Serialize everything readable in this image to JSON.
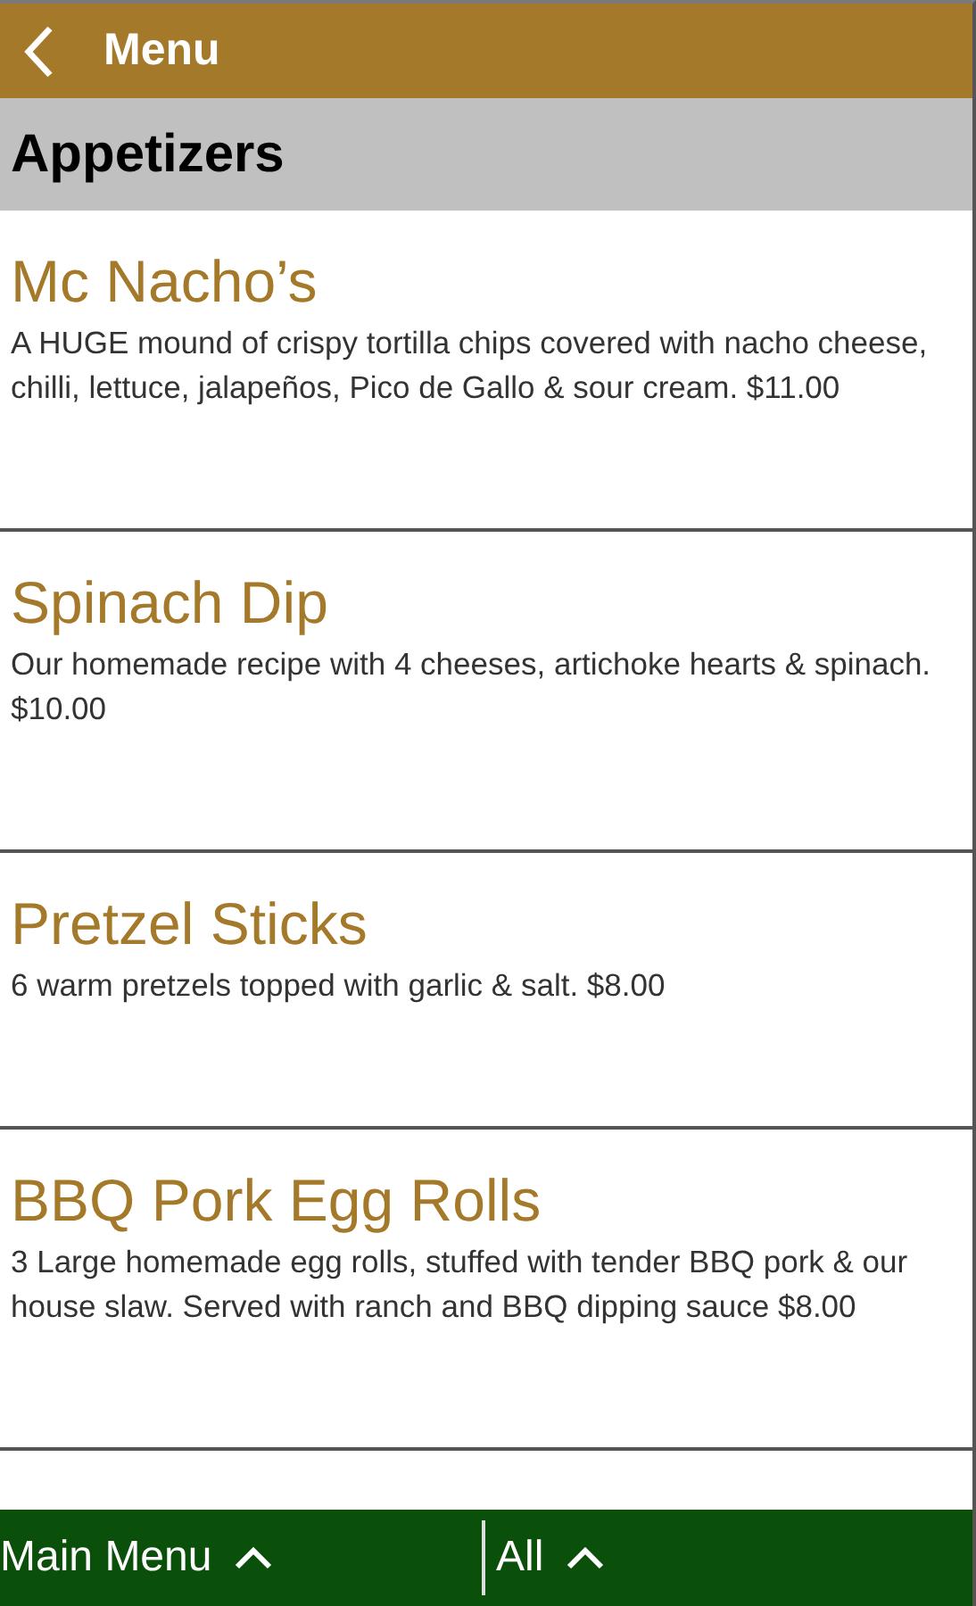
{
  "app_bar": {
    "title": "Menu"
  },
  "section": {
    "title": "Appetizers"
  },
  "items": [
    {
      "name": "Mc Nacho’s",
      "description": "A HUGE mound of crispy tortilla chips covered with nacho cheese, chilli, lettuce, jalapeños, Pico de Gallo & sour cream. $11.00"
    },
    {
      "name": "Spinach Dip",
      "description": "Our homemade recipe with 4 cheeses, artichoke hearts & spinach. $10.00"
    },
    {
      "name": "Pretzel Sticks",
      "description": "6 warm pretzels topped with garlic & salt.  $8.00"
    },
    {
      "name": "BBQ Pork Egg Rolls",
      "description": "3 Large homemade egg rolls, stuffed with tender BBQ pork & our house slaw. Served with ranch and BBQ dipping sauce $8.00"
    }
  ],
  "bottom_bar": [
    {
      "label": "Main Menu"
    },
    {
      "label": "All"
    }
  ]
}
